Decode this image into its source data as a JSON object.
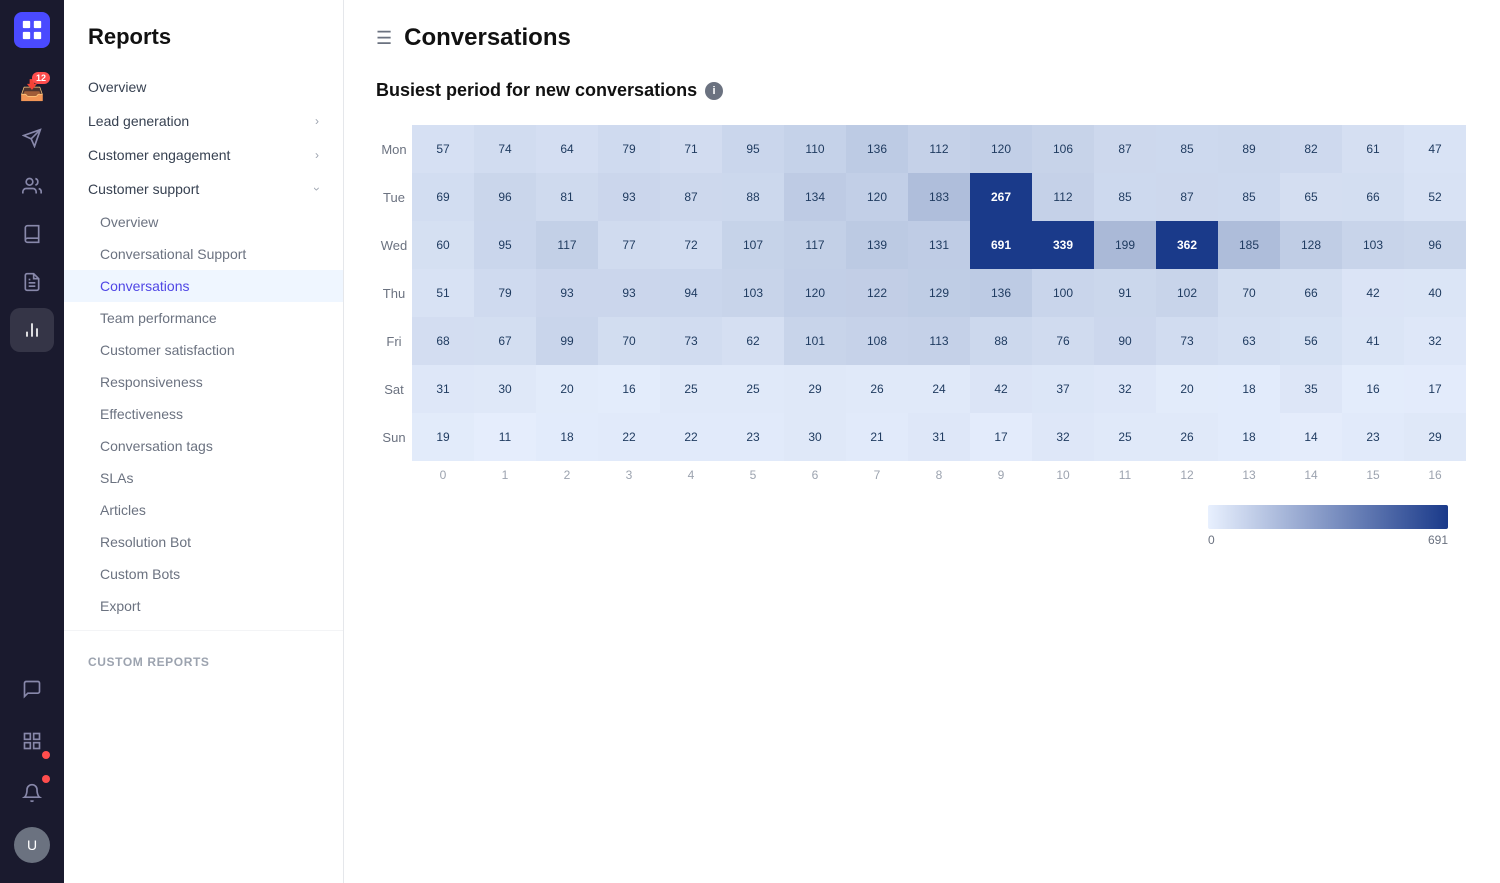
{
  "app": {
    "title": "Reports",
    "page_title": "Conversations",
    "section_title": "Busiest period for new conversations"
  },
  "icon_sidebar": {
    "badge_count": "12",
    "icons": [
      {
        "name": "inbox-icon",
        "symbol": "📥",
        "active": false,
        "badge": "12"
      },
      {
        "name": "send-icon",
        "symbol": "✉",
        "active": false,
        "badge": null
      },
      {
        "name": "contacts-icon",
        "symbol": "👥",
        "active": false,
        "badge": null
      },
      {
        "name": "books-icon",
        "symbol": "📚",
        "active": false,
        "badge": null
      },
      {
        "name": "notes-icon",
        "symbol": "📋",
        "active": false,
        "badge": null
      },
      {
        "name": "reports-icon",
        "symbol": "📊",
        "active": true,
        "badge": null
      },
      {
        "name": "chat-icon",
        "symbol": "💬",
        "active": false,
        "badge": null
      },
      {
        "name": "apps-icon",
        "symbol": "⊞",
        "active": false,
        "badge": null
      },
      {
        "name": "bell-icon",
        "symbol": "🔔",
        "active": false,
        "badge": null
      }
    ]
  },
  "left_nav": {
    "title": "Reports",
    "items": [
      {
        "label": "Overview",
        "type": "item",
        "active": false,
        "indent": 0
      },
      {
        "label": "Lead generation",
        "type": "item",
        "active": false,
        "indent": 0,
        "chevron": true
      },
      {
        "label": "Customer engagement",
        "type": "item",
        "active": false,
        "indent": 0,
        "chevron": true
      },
      {
        "label": "Customer support",
        "type": "item",
        "active": false,
        "indent": 0,
        "chevron": true,
        "expanded": true
      },
      {
        "label": "Overview",
        "type": "subitem",
        "active": false,
        "indent": 1
      },
      {
        "label": "Conversational Support",
        "type": "subitem",
        "active": false,
        "indent": 1
      },
      {
        "label": "Conversations",
        "type": "subitem",
        "active": true,
        "indent": 1
      },
      {
        "label": "Team performance",
        "type": "subitem",
        "active": false,
        "indent": 1
      },
      {
        "label": "Customer satisfaction",
        "type": "subitem",
        "active": false,
        "indent": 1
      },
      {
        "label": "Responsiveness",
        "type": "subitem",
        "active": false,
        "indent": 1
      },
      {
        "label": "Effectiveness",
        "type": "subitem",
        "active": false,
        "indent": 1
      },
      {
        "label": "Conversation tags",
        "type": "subitem",
        "active": false,
        "indent": 1
      },
      {
        "label": "SLAs",
        "type": "subitem",
        "active": false,
        "indent": 1
      },
      {
        "label": "Articles",
        "type": "subitem",
        "active": false,
        "indent": 1
      },
      {
        "label": "Resolution Bot",
        "type": "subitem",
        "active": false,
        "indent": 1
      },
      {
        "label": "Custom Bots",
        "type": "subitem",
        "active": false,
        "indent": 1
      },
      {
        "label": "Export",
        "type": "subitem",
        "active": false,
        "indent": 1
      }
    ],
    "custom_reports_label": "Custom reports"
  },
  "heatmap": {
    "rows": [
      {
        "day": "Mon",
        "values": [
          57,
          74,
          64,
          79,
          71,
          95,
          110,
          136,
          112,
          120,
          106,
          87,
          85,
          89,
          82,
          61,
          47
        ]
      },
      {
        "day": "Tue",
        "values": [
          69,
          96,
          81,
          93,
          87,
          88,
          134,
          120,
          183,
          267,
          112,
          85,
          87,
          85,
          65,
          66,
          52
        ]
      },
      {
        "day": "Wed",
        "values": [
          60,
          95,
          117,
          77,
          72,
          107,
          117,
          139,
          131,
          691,
          339,
          199,
          362,
          185,
          128,
          103,
          96
        ]
      },
      {
        "day": "Thu",
        "values": [
          51,
          79,
          93,
          93,
          94,
          103,
          120,
          122,
          129,
          136,
          100,
          91,
          102,
          70,
          66,
          42,
          40
        ]
      },
      {
        "day": "Fri",
        "values": [
          68,
          67,
          99,
          70,
          73,
          62,
          101,
          108,
          113,
          88,
          76,
          90,
          73,
          63,
          56,
          41,
          32
        ]
      },
      {
        "day": "Sat",
        "values": [
          31,
          30,
          20,
          16,
          25,
          25,
          29,
          26,
          24,
          42,
          37,
          32,
          20,
          18,
          35,
          16,
          17
        ]
      },
      {
        "day": "Sun",
        "values": [
          19,
          11,
          18,
          22,
          22,
          23,
          30,
          21,
          31,
          17,
          32,
          25,
          26,
          18,
          14,
          23,
          29
        ]
      }
    ],
    "hours": [
      0,
      1,
      2,
      3,
      4,
      5,
      6,
      7,
      8,
      9,
      10,
      11,
      12,
      13,
      14,
      15,
      16
    ],
    "max_value": 691,
    "min_value": 0,
    "legend_min": "0",
    "legend_max": "691",
    "highlighted_cells": [
      {
        "day": 1,
        "hour": 9,
        "value": 267
      },
      {
        "day": 2,
        "hour": 9,
        "value": 691
      },
      {
        "day": 2,
        "hour": 10,
        "value": 339
      },
      {
        "day": 2,
        "hour": 12,
        "value": 362
      }
    ]
  }
}
